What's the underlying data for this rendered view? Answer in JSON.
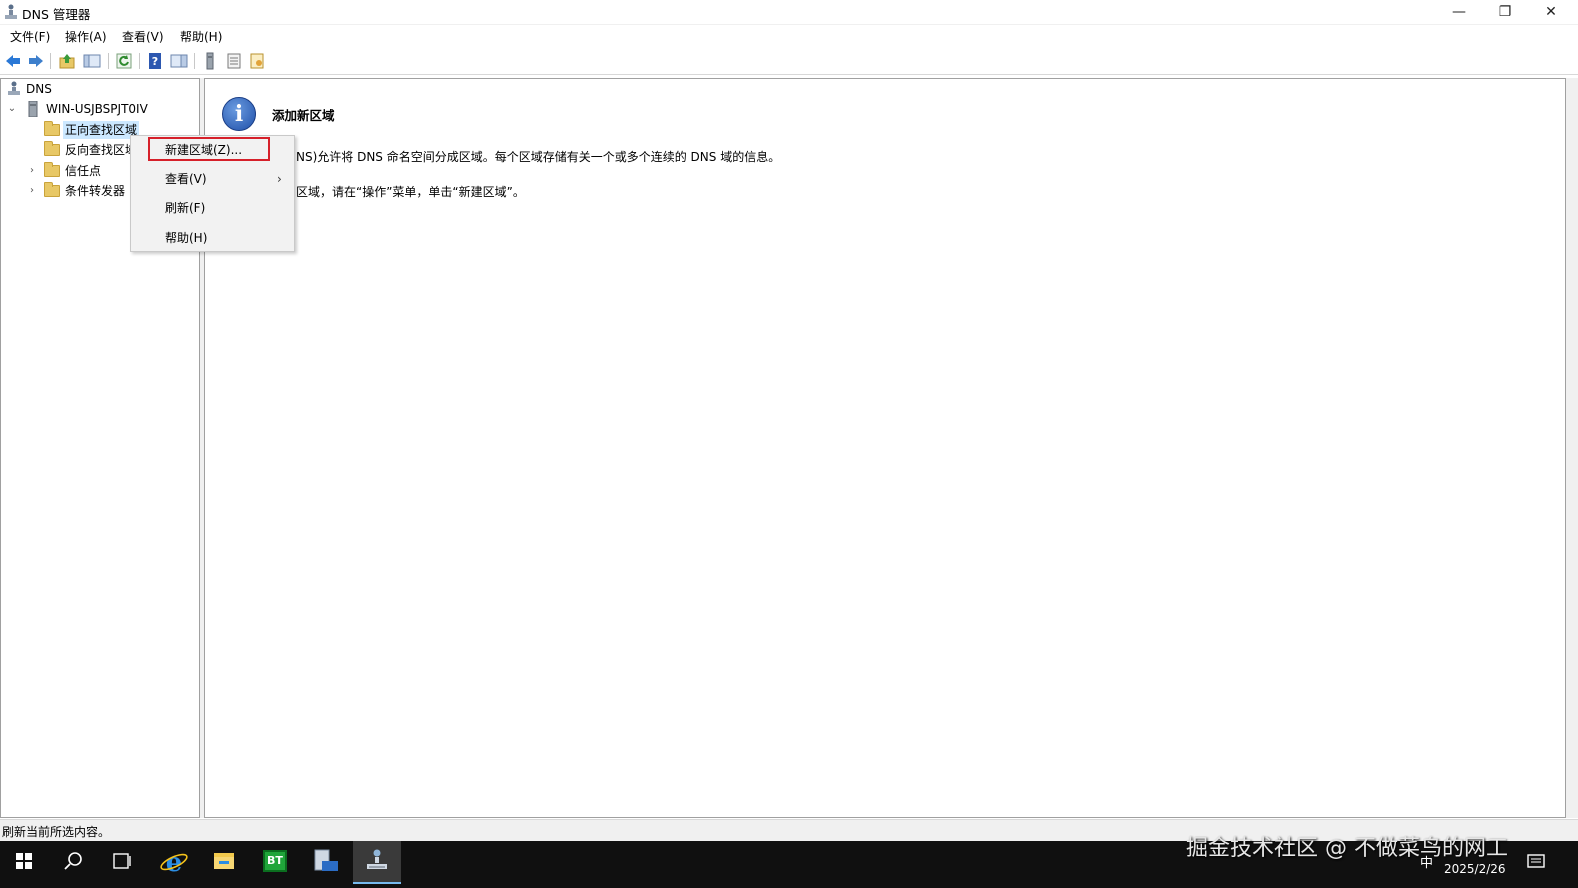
{
  "window": {
    "title": "DNS 管理器",
    "icon": "dns-manager-icon"
  },
  "window_controls": {
    "minimize": "—",
    "restore": "❐",
    "close": "✕"
  },
  "menubar": {
    "items": [
      "文件(F)",
      "操作(A)",
      "查看(V)",
      "帮助(H)"
    ]
  },
  "toolbar": {
    "icons": [
      "back-arrow-icon",
      "forward-arrow-icon",
      "up-folder-icon",
      "show-hide-console-tree-icon",
      "refresh-icon",
      "help-icon",
      "show-hide-action-pane-icon",
      "server-icon",
      "list-icon",
      "properties-icon"
    ]
  },
  "tree": {
    "root": "DNS",
    "server": "WIN-USJBSPJT0IV",
    "children": [
      "正向查找区域",
      "反向查找区域",
      "信任点",
      "条件转发器"
    ]
  },
  "result": {
    "heading": "添加新区域",
    "line1": "NS)允许将 DNS 命名空间分成区域。每个区域存储有关一个或多个连续的 DNS 域的信息。",
    "line2": "区域，请在“操作”菜单，单击“新建区域”。"
  },
  "context_menu": {
    "items": [
      {
        "label": "新建区域(Z)..."
      },
      {
        "label": "查看(V)",
        "arrow": "›"
      },
      {
        "label": "刷新(F)"
      },
      {
        "label": "帮助(H)"
      }
    ],
    "highlight_color": "#d6202a"
  },
  "status": {
    "text": "刷新当前所选内容。"
  },
  "taskbar": {
    "items": [
      "start-icon",
      "search-icon",
      "task-view-icon",
      "ie-icon",
      "file-explorer-icon",
      "bt-panel-icon",
      "server-manager-icon",
      "dns-manager-icon"
    ],
    "bt_label": "BT",
    "tray_ime": "中",
    "tray_date": "2025/2/26"
  },
  "watermark": "掘金技术社区 @ 不做菜鸟的网工"
}
